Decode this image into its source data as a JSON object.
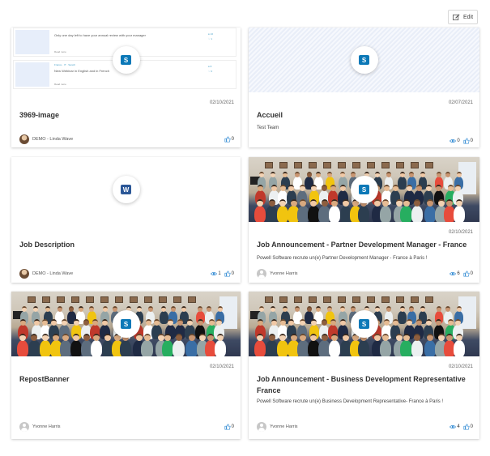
{
  "toolbar": {
    "edit_label": "Edit"
  },
  "preview": {
    "row1_text": "Only one day left to have your annual review with your manager",
    "row1_read": "Read more",
    "row2_tag": "France · IT · Sanofi",
    "row2_text": "New Webinar in English and in French",
    "row2_read": "Read more"
  },
  "cards": [
    {
      "title": "3969-image",
      "date": "02/10/2021",
      "desc": "",
      "author": "DEMO - Linda Wave",
      "views": "",
      "likes": "0",
      "app": "sharepoint"
    },
    {
      "title": "Accueil",
      "date": "02/07/2021",
      "desc": "Test Team",
      "author": "",
      "views": "0",
      "likes": "0",
      "app": "sharepoint"
    },
    {
      "title": "Job Description",
      "date": "",
      "desc": "",
      "author": "DEMO - Linda Wave",
      "views": "1",
      "likes": "0",
      "app": "word"
    },
    {
      "title": "Job Announcement - Partner Development Manager - France",
      "date": "02/10/2021",
      "desc": "Powell Software recrute un(e) Partner Development Manager - France à Paris !",
      "author": "Yvonne Harris",
      "views": "6",
      "likes": "0",
      "app": "sharepoint"
    },
    {
      "title": "RepostBanner",
      "date": "02/10/2021",
      "desc": "",
      "author": "Yvonne Harris",
      "views": "",
      "likes": "0",
      "app": "sharepoint"
    },
    {
      "title": "Job Announcement - Business Development Representative France",
      "date": "02/10/2021",
      "desc": "Powell Software recrute un(e) Business Development Representative- France à Paris !",
      "author": "Yvonne Harris",
      "views": "4",
      "likes": "0",
      "app": "sharepoint"
    }
  ],
  "app_letters": {
    "sharepoint": "S",
    "word": "W"
  },
  "colors": {
    "accent": "#0b78b7",
    "word": "#2b5797",
    "icon_blue": "#3c91d6"
  },
  "icons": [
    "edit-icon",
    "sharepoint-icon",
    "word-icon",
    "eye-icon",
    "thumbs-up-icon",
    "avatar-icon"
  ]
}
